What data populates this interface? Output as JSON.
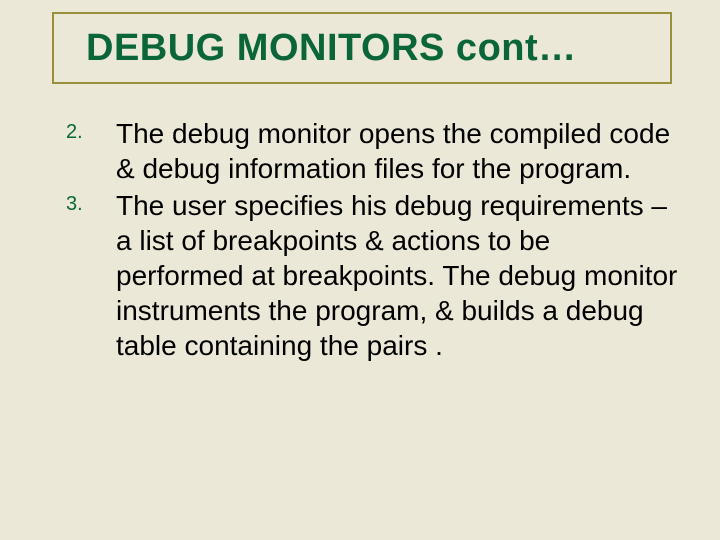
{
  "title": "DEBUG MONITORS cont…",
  "list": {
    "start": 2,
    "items": [
      {
        "num": "2.",
        "text": "The debug monitor opens the compiled code & debug information files for the program."
      },
      {
        "num": "3.",
        "text": "The user specifies his debug requirements – a list of breakpoints & actions to be performed at breakpoints. The debug monitor instruments the program, & builds a debug table containing the pairs ."
      }
    ]
  },
  "colors": {
    "background": "#ebe8d7",
    "title_text": "#0a6638",
    "title_border": "#9a8f3a",
    "body_text": "#000000"
  }
}
